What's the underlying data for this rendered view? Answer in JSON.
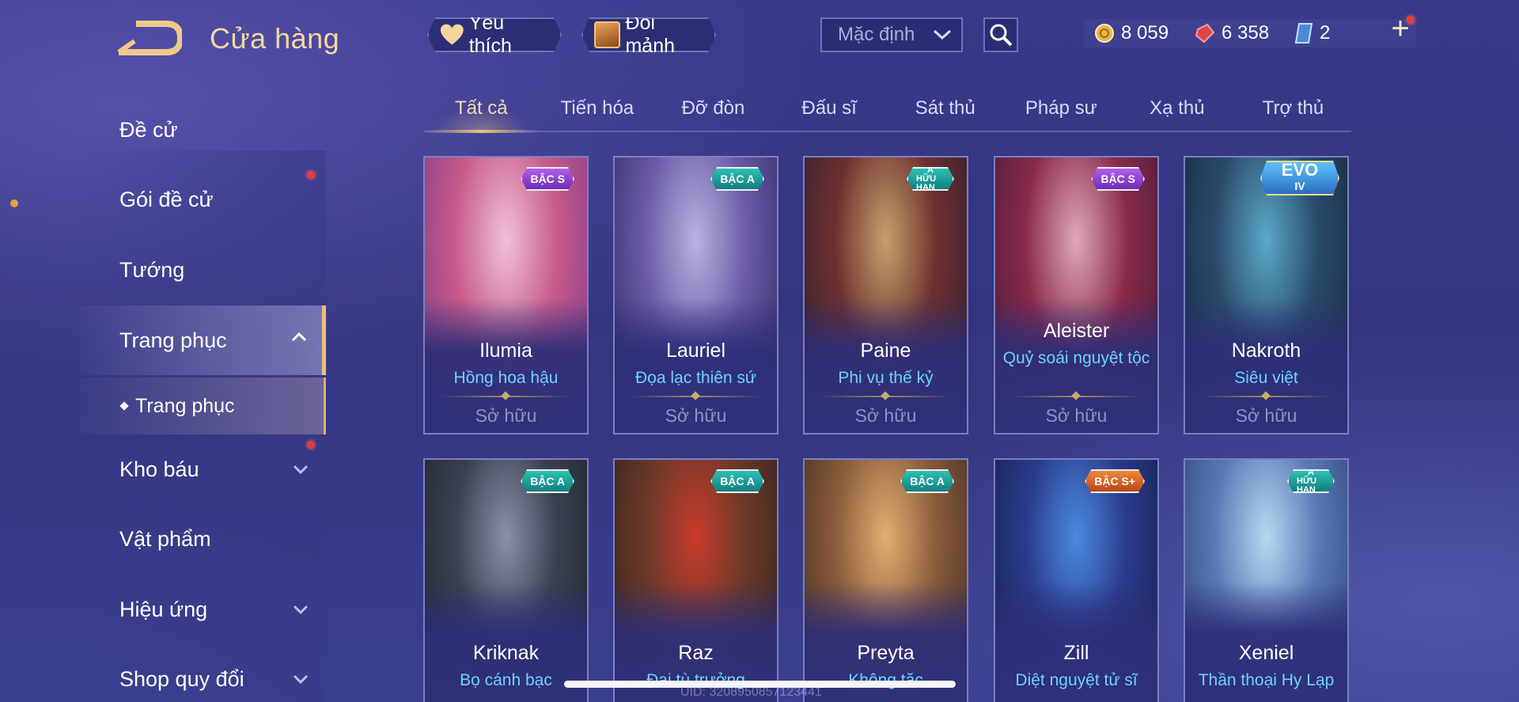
{
  "header": {
    "title": "Cửa hàng",
    "favorite_label": "Yêu thích",
    "exchange_label": "Đổi mảnh",
    "sort": {
      "selected": "Mặc định"
    }
  },
  "currency": {
    "gold": "8 059",
    "voucher": "6 358",
    "crystal": "2"
  },
  "sidebar": {
    "items": [
      {
        "label": "Đề cử"
      },
      {
        "label": "Gói đề cử"
      },
      {
        "label": "Tướng"
      },
      {
        "label": "Trang phục"
      },
      {
        "label": "Kho báu"
      },
      {
        "label": "Vật phẩm"
      },
      {
        "label": "Hiệu ứng"
      },
      {
        "label": "Shop quy đổi"
      }
    ],
    "sub_item": "Trang phục"
  },
  "tabs": [
    "Tất cả",
    "Tiến hóa",
    "Đỡ đòn",
    "Đấu sĩ",
    "Sát thủ",
    "Pháp sư",
    "Xạ thủ",
    "Trợ thủ"
  ],
  "cards": [
    {
      "hero": "Ilumia",
      "skin": "Hồng hoa hậu",
      "status": "Sở hữu",
      "badge": "BẬC S",
      "badge_type": "s",
      "art": [
        "#f0c0d8",
        "#c75a8a",
        "#7a3a8a"
      ]
    },
    {
      "hero": "Lauriel",
      "skin": "Đọa lạc thiên sứ",
      "status": "Sở hữu",
      "badge": "BẬC A",
      "badge_type": "a",
      "art": [
        "#b9b3e0",
        "#6a5aa8",
        "#2c2660"
      ]
    },
    {
      "hero": "Paine",
      "skin": "Phi vụ thế kỷ",
      "status": "Sở hữu",
      "badge_top": "A",
      "badge_bottom": "HỮU HẠN",
      "badge_type": "limited",
      "art": [
        "#c9a06a",
        "#6a3030",
        "#2a1c30"
      ]
    },
    {
      "hero": "Aleister",
      "skin": "Quỷ soái nguyệt tộc",
      "status": "Sở hữu",
      "badge": "BẬC S",
      "badge_type": "s",
      "art": [
        "#e0a8b8",
        "#8a2a4a",
        "#3a1a3a"
      ]
    },
    {
      "hero": "Nakroth",
      "skin": "Siêu việt",
      "status": "Sở hữu",
      "badge_top": "EVO",
      "badge_bottom": "IV",
      "badge_type": "evo",
      "art": [
        "#5aa8c8",
        "#2a4a6a",
        "#16233a"
      ]
    },
    {
      "hero": "Kriknak",
      "skin": "Bọ cánh bạc",
      "status": "",
      "badge": "BẬC A",
      "badge_type": "a",
      "art": [
        "#8a90a8",
        "#3a4050",
        "#1c2028"
      ]
    },
    {
      "hero": "Raz",
      "skin": "Đại tù trưởng",
      "status": "",
      "badge": "BẬC A",
      "badge_type": "a",
      "art": [
        "#c83a2a",
        "#6a3a2a",
        "#2a1c1a"
      ]
    },
    {
      "hero": "Preyta",
      "skin": "Không tặc",
      "status": "",
      "badge": "BẬC A",
      "badge_type": "a",
      "art": [
        "#e0b070",
        "#8a5a3a",
        "#3a2a20"
      ]
    },
    {
      "hero": "Zill",
      "skin": "Diệt nguyệt tử sĩ",
      "status": "",
      "badge": "BẬC S+",
      "badge_type": "sp",
      "art": [
        "#4a8ae0",
        "#2a3a8a",
        "#141c48"
      ]
    },
    {
      "hero": "Xeniel",
      "skin": "Thần thoại Hy Lạp",
      "status": "",
      "badge_top": "A",
      "badge_bottom": "HỮU HẠN",
      "badge_type": "limited",
      "art": [
        "#b8d8f0",
        "#5a7ab8",
        "#2a3a70"
      ]
    }
  ],
  "footer": {
    "uid": "UID: 3208950857123441"
  }
}
